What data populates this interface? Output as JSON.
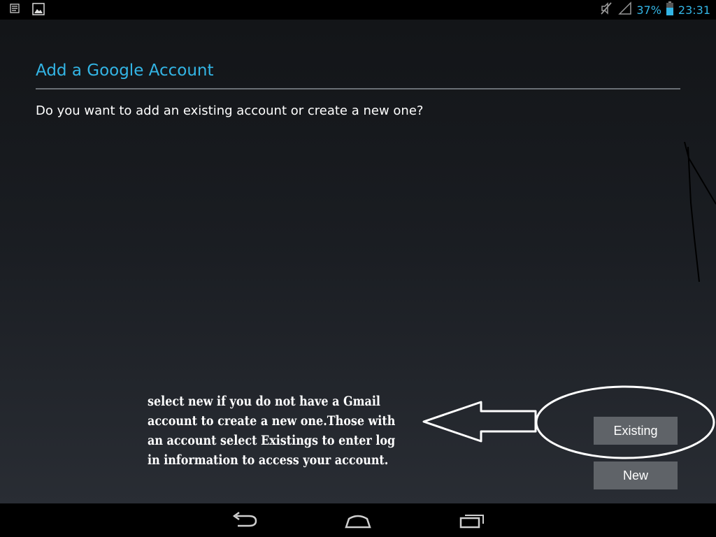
{
  "status_bar": {
    "notification_icons": [
      "list-icon",
      "image-icon"
    ],
    "battery_percent": "37%",
    "time": "23:31",
    "status_icons": [
      "mute-icon",
      "signal-icon",
      "battery-icon"
    ]
  },
  "dialog": {
    "title": "Add a Google Account",
    "question": "Do you want to add an existing account or create a new one?",
    "buttons": {
      "existing_label": "Existing",
      "new_label": "New"
    }
  },
  "annotation": {
    "lines": [
      "select new if you do not have a Gmail",
      "account to create a new one.Those with",
      "an account select Existings to enter log",
      "in information to access your account."
    ]
  },
  "nav_bar": {
    "icons": [
      "back-icon",
      "home-icon",
      "recent-apps-icon"
    ]
  },
  "colors": {
    "accent": "#33b5e5",
    "button_bg": "#5f6368",
    "bar_bg": "#000000"
  }
}
